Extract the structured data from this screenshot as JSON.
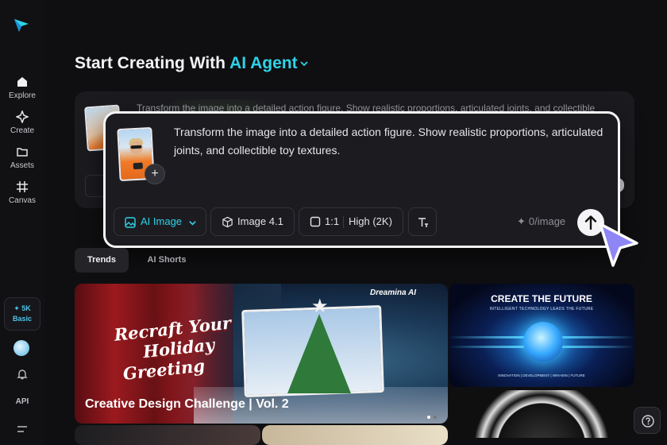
{
  "sidebar": {
    "items": [
      {
        "label": "Explore",
        "icon": "home-icon"
      },
      {
        "label": "Create",
        "icon": "sparkle-icon"
      },
      {
        "label": "Assets",
        "icon": "folder-icon"
      },
      {
        "label": "Canvas",
        "icon": "canvas-icon"
      }
    ],
    "credits": {
      "value": "✦ 5K",
      "plan": "Basic"
    },
    "api_label": "API"
  },
  "header": {
    "title_prefix": "Start Creating With",
    "title_accent": "AI Agent"
  },
  "background_composer": {
    "prompt_preview": "Transform the image into a detailed action figure. Show realistic proportions, articulated joints, and collectible"
  },
  "composer": {
    "prompt": "Transform the image into a detailed action figure. Show realistic proportions, articulated joints, and collectible toy textures.",
    "add_label": "+",
    "mode": "AI Image",
    "model": "Image 4.1",
    "ratio": "1:1",
    "quality": "High (2K)",
    "cost": "0/image"
  },
  "tabs": [
    {
      "label": "Trends",
      "active": true
    },
    {
      "label": "AI Shorts",
      "active": false
    }
  ],
  "cards": {
    "main": {
      "headline_lines": [
        "Recraft Your",
        "Holiday",
        "Greeting"
      ],
      "brand": "Dreamina AI",
      "caption": "Creative Design Challenge | Vol. 2",
      "slides_total": 2,
      "slide_active": 1
    },
    "future": {
      "title": "CREATE THE FUTURE",
      "subtitle": "INTELLIGENT TECHNOLOGY LEADS THE FUTURE",
      "footer": "INNOVATION | DEVELOPMENT | WIN-WIN | FUTURE"
    }
  },
  "colors": {
    "accent": "#2ED3E6",
    "background": "#0F0F11",
    "cursor": "#8E86F5"
  }
}
